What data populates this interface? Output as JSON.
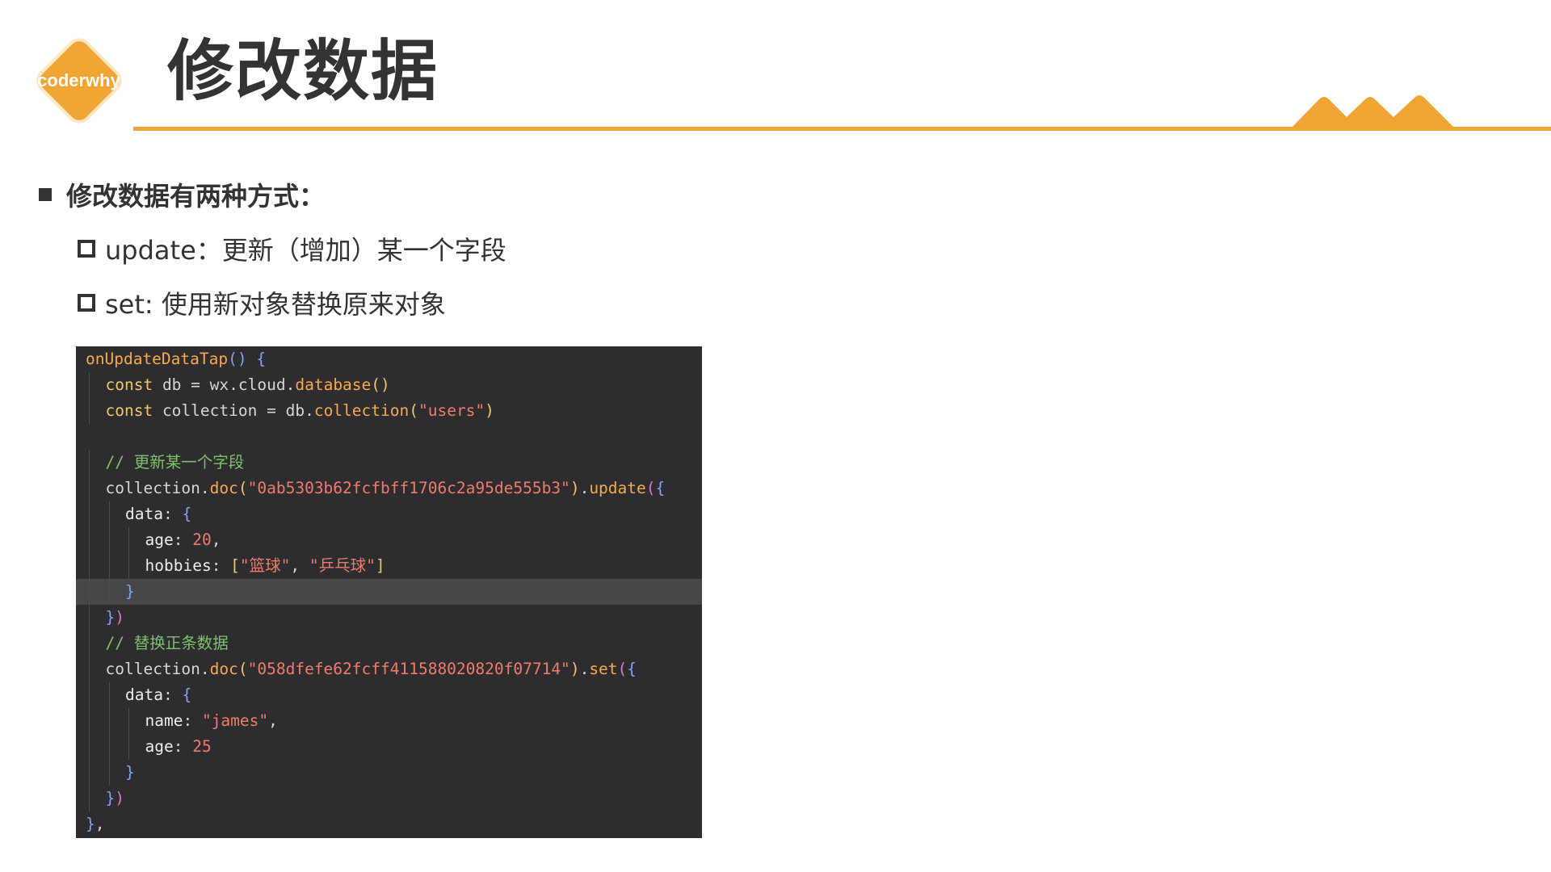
{
  "logo": {
    "text": "coderwhy",
    "color": "#f0a433"
  },
  "title": "修改数据",
  "accent_color": "#f0a433",
  "bullets": {
    "main": "修改数据有两种方式：",
    "items": [
      {
        "text": "update：更新（增加）某一个字段"
      },
      {
        "text": "set: 使用新对象替换原来对象"
      }
    ]
  },
  "code": {
    "lines": [
      {
        "indent": 0,
        "tokens": [
          [
            "fn",
            "onUpdateDataTap"
          ],
          [
            "b1",
            "()"
          ],
          [
            "op",
            " "
          ],
          [
            "b1",
            "{"
          ]
        ]
      },
      {
        "indent": 1,
        "tokens": [
          [
            "kw",
            "const"
          ],
          [
            "var",
            " db "
          ],
          [
            "op",
            "="
          ],
          [
            "var",
            " wx"
          ],
          [
            "op",
            "."
          ],
          [
            "var",
            "cloud"
          ],
          [
            "op",
            "."
          ],
          [
            "fn",
            "database"
          ],
          [
            "b3",
            "()"
          ]
        ]
      },
      {
        "indent": 1,
        "tokens": [
          [
            "kw",
            "const"
          ],
          [
            "var",
            " collection "
          ],
          [
            "op",
            "="
          ],
          [
            "var",
            " db"
          ],
          [
            "op",
            "."
          ],
          [
            "fn",
            "collection"
          ],
          [
            "b3",
            "("
          ],
          [
            "str",
            "\"users\""
          ],
          [
            "b3",
            ")"
          ]
        ]
      },
      {
        "indent": 0,
        "tokens": []
      },
      {
        "indent": 1,
        "tokens": [
          [
            "cm",
            "// 更新某一个字段"
          ]
        ]
      },
      {
        "indent": 1,
        "tokens": [
          [
            "var",
            "collection"
          ],
          [
            "op",
            "."
          ],
          [
            "fn",
            "doc"
          ],
          [
            "b3",
            "("
          ],
          [
            "str",
            "\"0ab5303b62fcfbff1706c2a95de555b3\""
          ],
          [
            "b3",
            ")"
          ],
          [
            "op",
            "."
          ],
          [
            "fn",
            "update"
          ],
          [
            "b2",
            "("
          ],
          [
            "b1",
            "{"
          ]
        ]
      },
      {
        "indent": 2,
        "tokens": [
          [
            "prop",
            "data"
          ],
          [
            "op",
            ": "
          ],
          [
            "b1",
            "{"
          ]
        ]
      },
      {
        "indent": 3,
        "tokens": [
          [
            "prop",
            "age"
          ],
          [
            "op",
            ": "
          ],
          [
            "num",
            "20"
          ],
          [
            "op",
            ","
          ]
        ]
      },
      {
        "indent": 3,
        "tokens": [
          [
            "prop",
            "hobbies"
          ],
          [
            "op",
            ": "
          ],
          [
            "b3",
            "["
          ],
          [
            "str",
            "\"篮球\""
          ],
          [
            "op",
            ", "
          ],
          [
            "str",
            "\"乒乓球\""
          ],
          [
            "b3",
            "]"
          ]
        ]
      },
      {
        "indent": 2,
        "tokens": [
          [
            "b1",
            "}"
          ]
        ],
        "highlight": true
      },
      {
        "indent": 1,
        "tokens": [
          [
            "b1",
            "}"
          ],
          [
            "b2",
            ")"
          ]
        ]
      },
      {
        "indent": 1,
        "tokens": [
          [
            "cm",
            "// 替换正条数据"
          ]
        ]
      },
      {
        "indent": 1,
        "tokens": [
          [
            "var",
            "collection"
          ],
          [
            "op",
            "."
          ],
          [
            "fn",
            "doc"
          ],
          [
            "b3",
            "("
          ],
          [
            "str",
            "\"058dfefe62fcff411588020820f07714\""
          ],
          [
            "b3",
            ")"
          ],
          [
            "op",
            "."
          ],
          [
            "fn",
            "set"
          ],
          [
            "b2",
            "("
          ],
          [
            "b1",
            "{"
          ]
        ]
      },
      {
        "indent": 2,
        "tokens": [
          [
            "prop",
            "data"
          ],
          [
            "op",
            ": "
          ],
          [
            "b1",
            "{"
          ]
        ]
      },
      {
        "indent": 3,
        "tokens": [
          [
            "prop",
            "name"
          ],
          [
            "op",
            ": "
          ],
          [
            "str",
            "\"james\""
          ],
          [
            "op",
            ","
          ]
        ]
      },
      {
        "indent": 3,
        "tokens": [
          [
            "prop",
            "age"
          ],
          [
            "op",
            ": "
          ],
          [
            "num",
            "25"
          ]
        ]
      },
      {
        "indent": 2,
        "tokens": [
          [
            "b1",
            "}"
          ]
        ]
      },
      {
        "indent": 1,
        "tokens": [
          [
            "b1",
            "}"
          ],
          [
            "b2",
            ")"
          ]
        ]
      },
      {
        "indent": 0,
        "tokens": [
          [
            "b1",
            "}"
          ],
          [
            "op",
            ","
          ]
        ]
      }
    ]
  }
}
